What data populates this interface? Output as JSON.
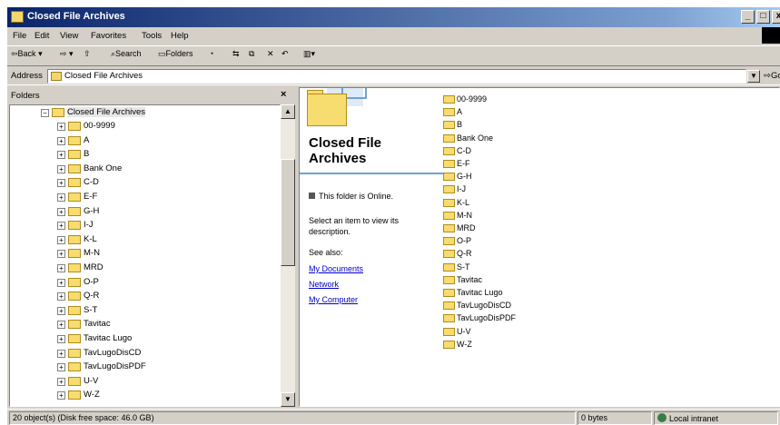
{
  "window": {
    "title": "Closed File Archives",
    "controls": {
      "minimize": "_",
      "maximize": "□",
      "close": "x"
    }
  },
  "menu": [
    "File",
    "Edit",
    "View",
    "Favorites",
    "Tools",
    "Help"
  ],
  "toolbar": {
    "back_label": "Back",
    "search_label": "Search",
    "folders_label": "Folders"
  },
  "address": {
    "label": "Address",
    "value": "Closed File Archives",
    "go_label": "Go"
  },
  "folder_pane": {
    "header": "Folders",
    "close_glyph": "×",
    "root": "Closed File Archives",
    "items": [
      "00-9999",
      "A",
      "B",
      "Bank One",
      "C-D",
      "E-F",
      "G-H",
      "I-J",
      "K-L",
      "M-N",
      "MRD",
      "O-P",
      "Q-R",
      "S-T",
      "Tavitac",
      "Tavitac Lugo",
      "TavLugoDisCD",
      "TavLugoDisPDF",
      "U-V",
      "W-Z"
    ]
  },
  "task_pane": {
    "title": "Closed File Archives",
    "status": "This folder is Online.",
    "description": "Select an item to view its description.",
    "see_also_label": "See also:",
    "links": [
      "My Documents",
      "Network",
      "My Computer"
    ]
  },
  "file_list": [
    "00-9999",
    "A",
    "B",
    "Bank One",
    "C-D",
    "E-F",
    "G-H",
    "I-J",
    "K-L",
    "M-N",
    "MRD",
    "O-P",
    "Q-R",
    "S-T",
    "Tavitac",
    "Tavitac Lugo",
    "TavLugoDisCD",
    "TavLugoDisPDF",
    "U-V",
    "W-Z"
  ],
  "status_bar": {
    "objects": "20 object(s) (Disk free space: 46.0 GB)",
    "size": "0 bytes",
    "zone": "Local intranet"
  }
}
